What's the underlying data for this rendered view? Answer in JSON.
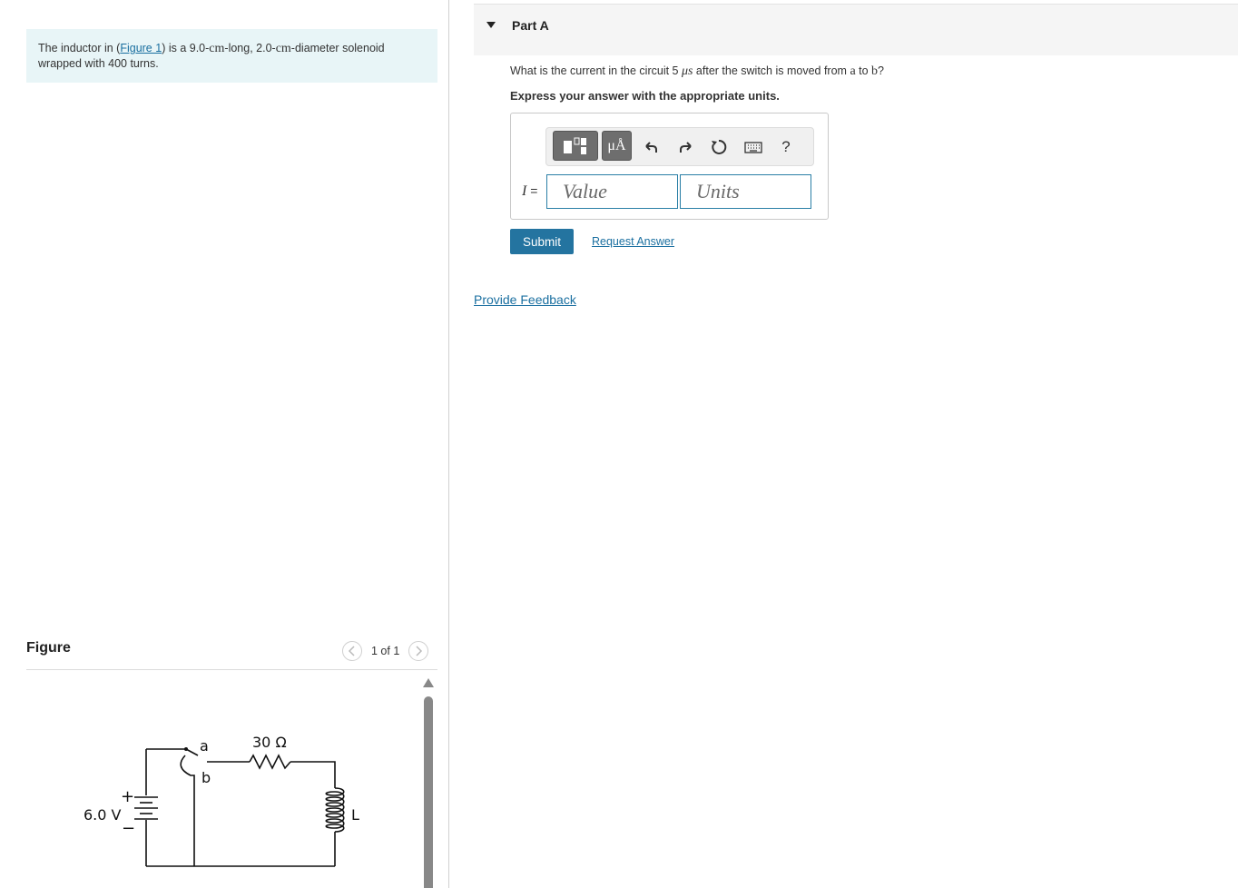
{
  "problem": {
    "text_before_link": "The inductor in (",
    "link_text": "Figure 1",
    "text_after_link": ") is a 9.0-",
    "unit_cm_1": "cm",
    "text_mid": "-long, 2.0-",
    "unit_cm_2": "cm",
    "text_end": "-diameter solenoid wrapped with 400 turns."
  },
  "figure": {
    "title": "Figure",
    "page_indicator": "1 of 1",
    "circuit": {
      "battery_label": "6.0 V",
      "plus_sign": "+",
      "minus_sign": "−",
      "resistor_label": "30 Ω",
      "switch_a": "a",
      "switch_b": "b",
      "inductor_label": "L"
    }
  },
  "part": {
    "title": "Part A",
    "question_pre": "What is the current in the circuit 5 ",
    "question_unit": "μs",
    "question_mid": " after the switch is moved from ",
    "question_a": "a",
    "question_to": " to ",
    "question_b": "b",
    "question_end": "?",
    "instruction": "Express your answer with the appropriate units.",
    "toolbar": {
      "units_button": "μÅ",
      "help_label": "?"
    },
    "variable": "I",
    "equals": "=",
    "value_placeholder": "Value",
    "units_placeholder": "Units",
    "submit_label": "Submit",
    "request_answer_label": "Request Answer"
  },
  "feedback_label": "Provide Feedback",
  "colors": {
    "accent": "#2474a0",
    "link": "#1a6fa0",
    "problem_bg": "#e8f5f7"
  }
}
